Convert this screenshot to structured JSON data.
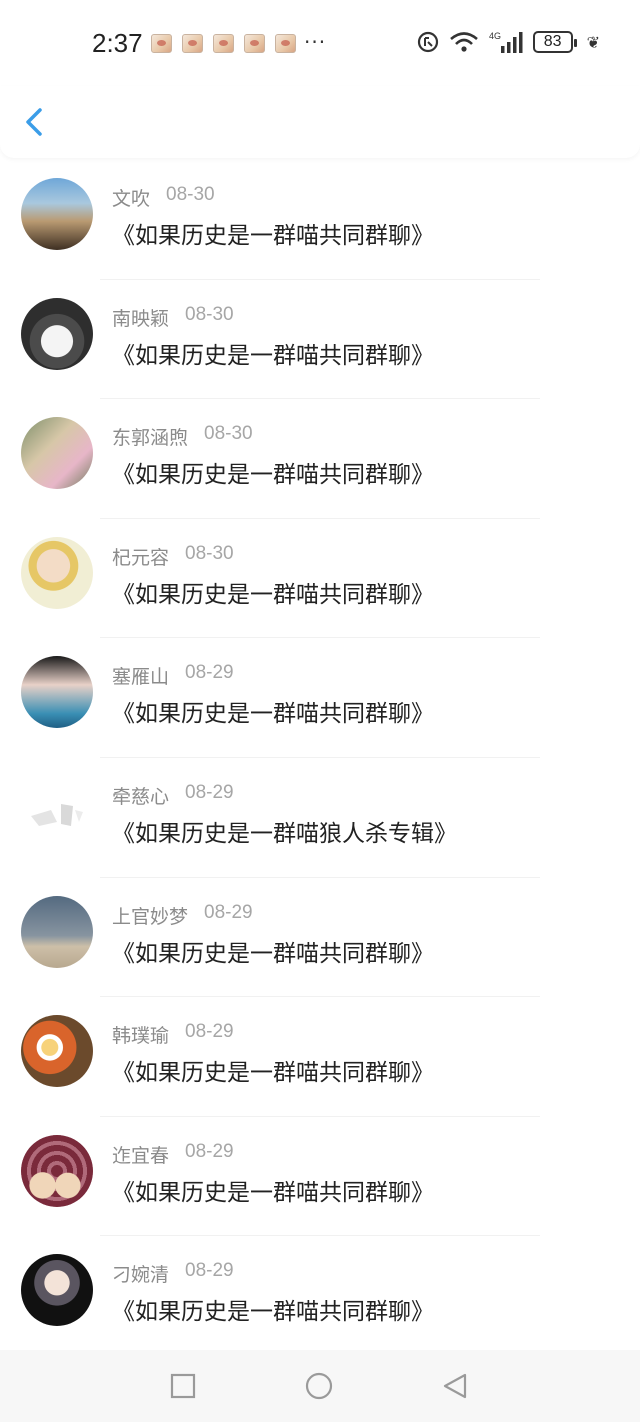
{
  "status_bar": {
    "time": "2:37",
    "more": "···",
    "network": "4G",
    "battery": "83"
  },
  "items": [
    {
      "name": "文吹",
      "date": "08-30",
      "title": "《如果历史是一群喵共同群聊》"
    },
    {
      "name": "南映颖",
      "date": "08-30",
      "title": "《如果历史是一群喵共同群聊》"
    },
    {
      "name": "东郭涵煦",
      "date": "08-30",
      "title": "《如果历史是一群喵共同群聊》"
    },
    {
      "name": "杞元容",
      "date": "08-30",
      "title": "《如果历史是一群喵共同群聊》"
    },
    {
      "name": "塞雁山",
      "date": "08-29",
      "title": "《如果历史是一群喵共同群聊》"
    },
    {
      "name": "牵慈心",
      "date": "08-29",
      "title": "《如果历史是一群喵狼人杀专辑》"
    },
    {
      "name": "上官妙梦",
      "date": "08-29",
      "title": "《如果历史是一群喵共同群聊》"
    },
    {
      "name": "韩璞瑜",
      "date": "08-29",
      "title": "《如果历史是一群喵共同群聊》"
    },
    {
      "name": "迮宜春",
      "date": "08-29",
      "title": "《如果历史是一群喵共同群聊》"
    },
    {
      "name": "刁婉清",
      "date": "08-29",
      "title": "《如果历史是一群喵共同群聊》"
    }
  ],
  "colors": {
    "accent": "#3b9de8",
    "name_text": "#8b8b8b",
    "title_text": "#222222"
  },
  "icons": {
    "back": "chevron-left-icon",
    "nav_recent": "square-icon",
    "nav_home": "circle-icon",
    "nav_back": "triangle-back-icon"
  }
}
